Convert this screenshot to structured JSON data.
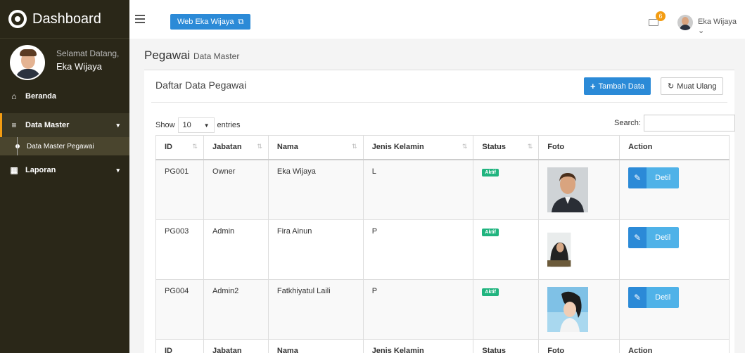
{
  "sidebar": {
    "brand": "Dashboard",
    "greeting": "Selamat Datang,",
    "user_name": "Eka Wijaya",
    "items": [
      {
        "label": "Beranda"
      },
      {
        "label": "Data Master"
      },
      {
        "label": "Data Master Pegawai"
      },
      {
        "label": "Laporan"
      }
    ]
  },
  "topbar": {
    "web_button": "Web Eka Wijaya",
    "notification_count": "6",
    "user_name": "Eka Wijaya"
  },
  "page": {
    "title": "Pegawai",
    "subtitle": "Data Master"
  },
  "box": {
    "title": "Daftar Data Pegawai",
    "add_button": "Tambah Data",
    "reload_button": "Muat Ulang"
  },
  "table_controls": {
    "show_label": "Show",
    "length_value": "10",
    "entries_label": "entries",
    "search_label": "Search:"
  },
  "table": {
    "columns": [
      "ID",
      "Jabatan",
      "Nama",
      "Jenis Kelamin",
      "Status",
      "Foto",
      "Action"
    ],
    "rows": [
      {
        "id": "PG001",
        "jabatan": "Owner",
        "nama": "Eka Wijaya",
        "jk": "L",
        "status": "Aktif",
        "action": "Detil"
      },
      {
        "id": "PG003",
        "jabatan": "Admin",
        "nama": "Fira Ainun",
        "jk": "P",
        "status": "Aktif",
        "action": "Detil"
      },
      {
        "id": "PG004",
        "jabatan": "Admin2",
        "nama": "Fatkhiyatul Laili",
        "jk": "P",
        "status": "Aktif",
        "action": "Detil"
      }
    ]
  },
  "colors": {
    "sidebar_bg": "#2a2718",
    "accent_blue": "#2b8ad7",
    "status_green": "#21b47f",
    "badge_orange": "#f39c12"
  },
  "icons": [
    "dashboard-icon",
    "home-icon",
    "database-icon",
    "table-icon",
    "hamburger-icon",
    "external-link-icon",
    "mail-icon",
    "plus-icon",
    "refresh-icon",
    "pencil-icon",
    "sort-icon"
  ]
}
